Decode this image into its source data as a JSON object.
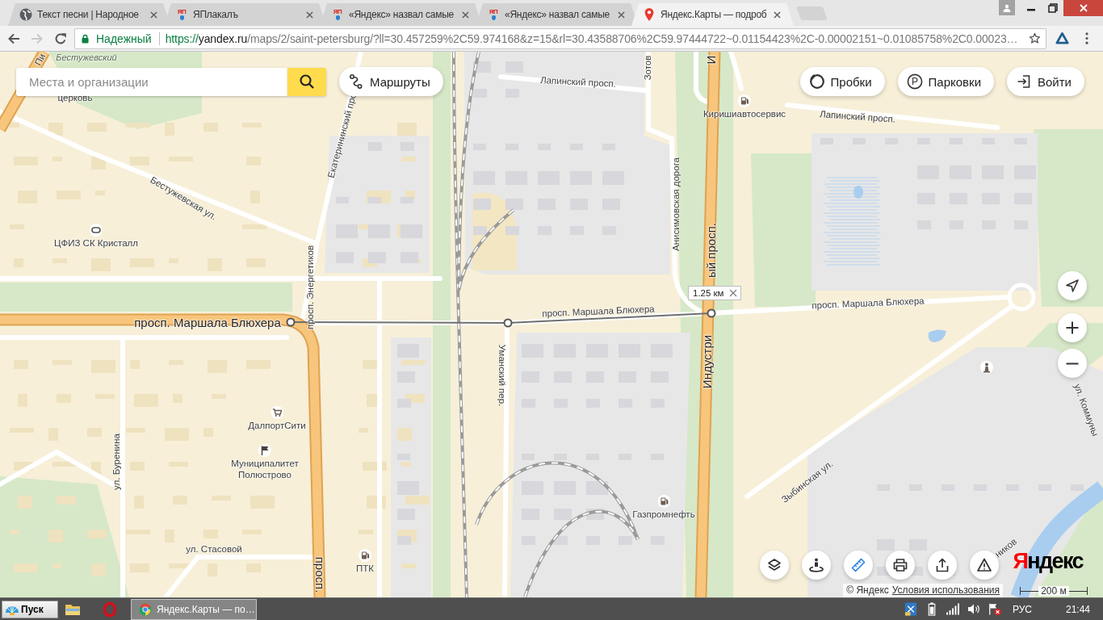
{
  "browser": {
    "tabs": [
      {
        "title": "Текст песни | Народное",
        "kind": "globe",
        "selected": false
      },
      {
        "title": "ЯПлакалъ",
        "kind": "logo",
        "favicon_text": "ЯП",
        "selected": false
      },
      {
        "title": "«Яндекс» назвал самые",
        "kind": "logo",
        "favicon_text": "ЯП",
        "selected": false
      },
      {
        "title": "«Яндекс» назвал самые",
        "kind": "logo",
        "favicon_text": "ЯП",
        "selected": false
      },
      {
        "title": "Яндекс.Карты — подроб",
        "kind": "pin",
        "selected": true
      }
    ],
    "nav": [
      {
        "kind": "back",
        "disabled": false
      },
      {
        "kind": "forward",
        "disabled": true
      },
      {
        "kind": "reload",
        "disabled": false
      }
    ],
    "address": {
      "security": "Надежный",
      "scheme": "https://",
      "host": "yandex.ru",
      "path": "/maps/2/saint-petersburg/?ll=30.457259%2C59.974168&z=15&rl=30.43588706%2C59.97444722~0.01154423%2C-0.00002151~0.01085758%2C0.00023…"
    }
  },
  "map": {
    "search": {
      "placeholder": "Места и организации"
    },
    "buttons": [
      {
        "label": "Маршруты",
        "kind": "routes"
      },
      {
        "label": "Пробки",
        "kind": "traffic"
      },
      {
        "label": "Парковки",
        "kind": "parking",
        "icon_text": "P"
      },
      {
        "label": "Войти",
        "kind": "login"
      }
    ],
    "labels": [
      {
        "text": "Пи",
        "kind": "street"
      },
      {
        "text": "Бестужевский",
        "kind": "park"
      },
      {
        "text": "Лапинский просп.",
        "kind": "street"
      },
      {
        "text": "Зотов",
        "kind": "street"
      },
      {
        "text": "И",
        "kind": "major"
      },
      {
        "text": "церковь",
        "kind": "place"
      },
      {
        "text": "Лапинский просп.",
        "kind": "street"
      },
      {
        "text": "Екатерининский про",
        "kind": "street"
      },
      {
        "text": "Анисимовская дорога",
        "kind": "street"
      },
      {
        "text": "Бестужевская ул.",
        "kind": "street"
      },
      {
        "text": "ый просп.",
        "kind": "major"
      },
      {
        "text": "просп. Энергетиков",
        "kind": "street"
      },
      {
        "text": "просп. Маршала Блюхера",
        "kind": "street"
      },
      {
        "text": "просп. Маршала Блюхера",
        "kind": "street"
      },
      {
        "text": "просп. Маршала Блюхера",
        "kind": "major"
      },
      {
        "text": "Индустри",
        "kind": "major"
      },
      {
        "text": "Уманский пер.",
        "kind": "street"
      },
      {
        "text": "ул. Коммуны",
        "kind": "street"
      },
      {
        "text": "ул. Буренина",
        "kind": "street"
      },
      {
        "text": "Зыбинская ул.",
        "kind": "street"
      },
      {
        "text": "ул. Стасовой",
        "kind": "street"
      },
      {
        "text": "просп.",
        "kind": "major"
      },
      {
        "text": "ников",
        "kind": "street"
      }
    ],
    "pois": [
      {
        "name": "Киришиавтосервис",
        "kind": "fuel"
      },
      {
        "name": "ЦФИЗ СК Кристалл",
        "kind": "sport"
      },
      {
        "kind": "monument"
      },
      {
        "name": "ДалпортСити",
        "kind": "shop"
      },
      {
        "name": "Муниципалитет Полюстрово",
        "kind": "flag"
      },
      {
        "name": "Газпромнефть",
        "kind": "fuel"
      },
      {
        "name": "ПТК",
        "kind": "fuel"
      }
    ],
    "measure": {
      "distance": "1.25 км"
    },
    "tools": [
      {
        "kind": "layers",
        "selected": false
      },
      {
        "kind": "panorama",
        "selected": false
      },
      {
        "kind": "ruler",
        "selected": true
      },
      {
        "kind": "print",
        "selected": false
      },
      {
        "kind": "share",
        "selected": false
      },
      {
        "kind": "report",
        "selected": false
      }
    ],
    "logo": "Яндекс",
    "copyright": "© Яндекс",
    "terms": "Условия использования",
    "scale": "200 м"
  },
  "taskbar": {
    "start": "Пуск",
    "tasks": [
      {
        "label": "Яндекс.Карты — по…",
        "selected": true
      }
    ],
    "language": "РУС",
    "time": "21:44"
  }
}
